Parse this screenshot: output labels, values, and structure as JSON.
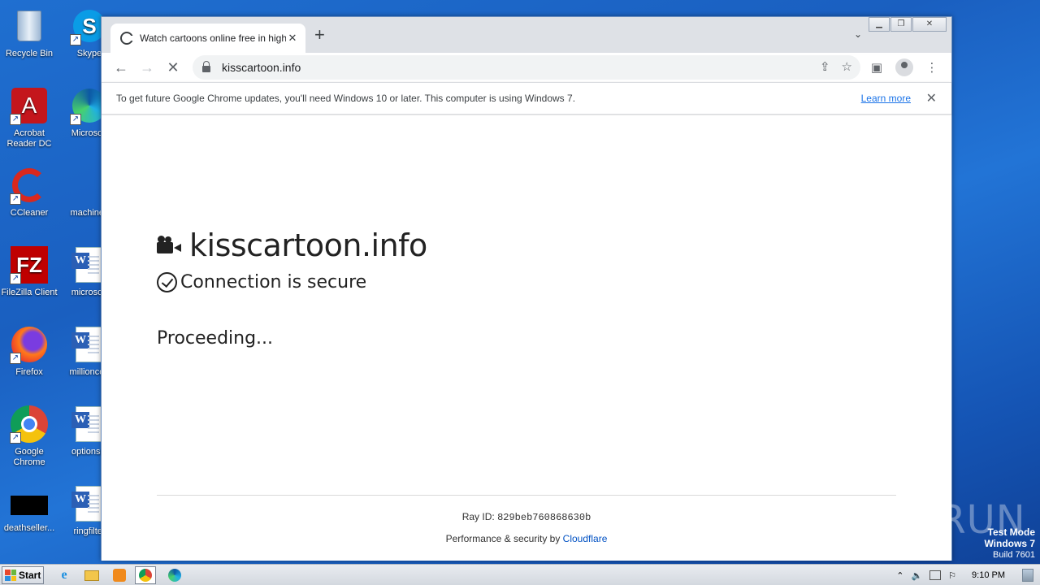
{
  "desktop": {
    "icons_col1": [
      {
        "label": "Recycle Bin",
        "icon": "recycle-bin-icon"
      },
      {
        "label": "Acrobat Reader DC",
        "icon": "acrobat-icon"
      },
      {
        "label": "CCleaner",
        "icon": "ccleaner-icon"
      },
      {
        "label": "FileZilla Client",
        "icon": "filezilla-icon"
      },
      {
        "label": "Firefox",
        "icon": "firefox-icon"
      },
      {
        "label": "Google Chrome",
        "icon": "chrome-icon"
      },
      {
        "label": "deathseller...",
        "icon": "black-file-icon"
      }
    ],
    "icons_col2": [
      {
        "label": "Skype",
        "icon": "skype-icon"
      },
      {
        "label": "Microsoft",
        "icon": "edge-icon"
      },
      {
        "label": "machinefi",
        "icon": "blank-file-icon"
      },
      {
        "label": "microsoft",
        "icon": "word-doc-icon"
      },
      {
        "label": "millioncon",
        "icon": "word-doc-icon"
      },
      {
        "label": "optionsst",
        "icon": "word-doc-icon"
      },
      {
        "label": "ringfilter",
        "icon": "word-doc-icon"
      }
    ],
    "watermark": "ANY RUN",
    "test_mode": {
      "line1": "Test Mode",
      "line2": "Windows 7",
      "line3": "Build 7601"
    }
  },
  "browser": {
    "tab_title": "Watch cartoons online free in high q",
    "tab_close": "✕",
    "new_tab": "+",
    "url": "kisscartoon.info",
    "infobar": {
      "message": "To get future Google Chrome updates, you'll need Windows 10 or later. This computer is using Windows 7.",
      "link": "Learn more"
    }
  },
  "page": {
    "site_name": "kisscartoon.info",
    "secure_text": "Connection is secure",
    "status": "Proceeding...",
    "ray_label": "Ray ID:",
    "ray_id": "829beb760868630b",
    "perf_label": "Performance & security by",
    "perf_link": "Cloudflare"
  },
  "taskbar": {
    "start_label": "Start",
    "clock": "9:10 PM"
  },
  "colors": {
    "link": "#1a73e8",
    "cloudflare": "#0051c3",
    "desktop": "#1f6fd0"
  }
}
